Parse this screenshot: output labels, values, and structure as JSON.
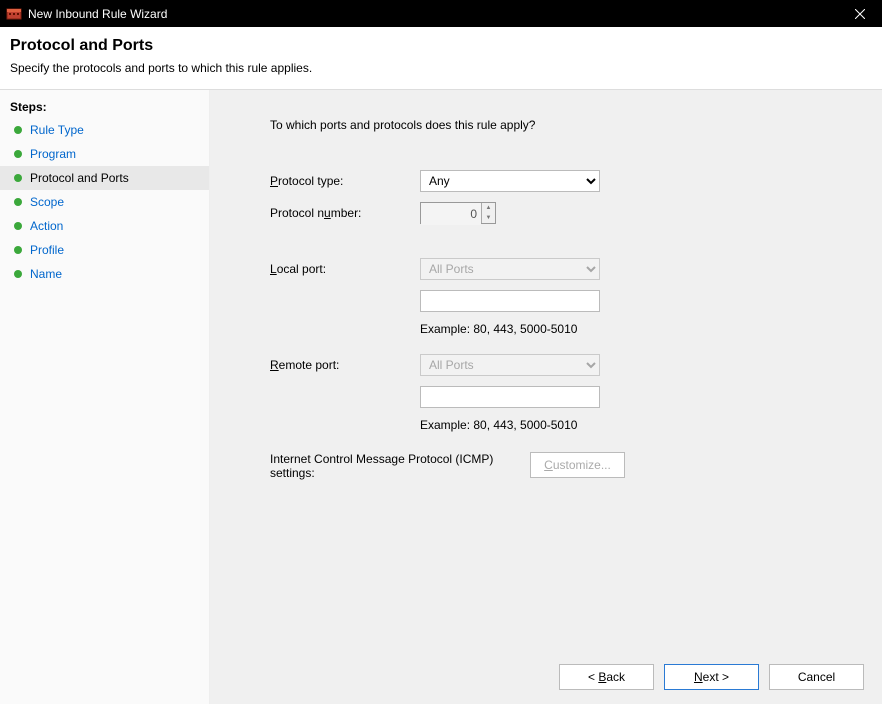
{
  "titlebar": {
    "title": "New Inbound Rule Wizard"
  },
  "header": {
    "title": "Protocol and Ports",
    "subtitle": "Specify the protocols and ports to which this rule applies."
  },
  "sidebar": {
    "steps_label": "Steps:",
    "items": [
      {
        "label": "Rule Type",
        "state": "done"
      },
      {
        "label": "Program",
        "state": "done"
      },
      {
        "label": "Protocol and Ports",
        "state": "current"
      },
      {
        "label": "Scope",
        "state": "future"
      },
      {
        "label": "Action",
        "state": "future"
      },
      {
        "label": "Profile",
        "state": "future"
      },
      {
        "label": "Name",
        "state": "future"
      }
    ]
  },
  "content": {
    "question": "To which ports and protocols does this rule apply?",
    "protocol_type_label": "Protocol type:",
    "protocol_type_value": "Any",
    "protocol_number_label": "Protocol number:",
    "protocol_number_value": "0",
    "local_port_label": "Local port:",
    "local_port_value": "All Ports",
    "remote_port_label": "Remote port:",
    "remote_port_value": "All Ports",
    "example_text": "Example: 80, 443, 5000-5010",
    "icmp_label": "Internet Control Message Protocol (ICMP) settings:",
    "customize_label": "Customize..."
  },
  "footer": {
    "back": "< Back",
    "next": "Next >",
    "cancel": "Cancel"
  }
}
